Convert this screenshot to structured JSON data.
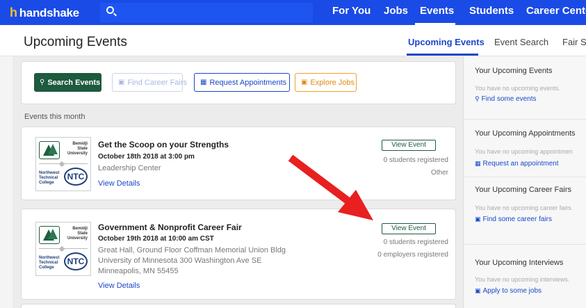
{
  "topnav": {
    "logo_text": "handshake",
    "search_icon": "search-icon",
    "items": [
      {
        "label": "For You"
      },
      {
        "label": "Jobs"
      },
      {
        "label": "Events"
      },
      {
        "label": "Students"
      },
      {
        "label": "Career Cente"
      }
    ],
    "active_item": "Events",
    "brand_color": "#1a4be6"
  },
  "subheader": {
    "title": "Upcoming Events",
    "tabs": [
      {
        "label": "Upcoming Events",
        "active": true
      },
      {
        "label": "Event Search"
      },
      {
        "label": "Fair S"
      }
    ]
  },
  "filters": {
    "search_events": "Search Events",
    "find_career_fairs": "Find Career Fairs",
    "request_appointments": "Request Appointments",
    "explore_jobs": "Explore Jobs"
  },
  "month_label": "Events this month",
  "events": [
    {
      "logo": {
        "school_line1": "Bemidji",
        "school_line2": "State",
        "school_line3": "University",
        "college_line1": "Northwest",
        "college_line2": "Technical",
        "college_line3": "College",
        "badge": "NTC"
      },
      "title": "Get the Scoop on your Strengths",
      "date": "October 18th 2018 at 3:00 pm",
      "location_lines": [
        "Leadership Center"
      ],
      "details_link": "View Details",
      "view_button": "View Event",
      "meta": [
        "0 students registered",
        "Other"
      ]
    },
    {
      "logo": {
        "school_line1": "Bemidji",
        "school_line2": "State",
        "school_line3": "University",
        "college_line1": "Northwest",
        "college_line2": "Technical",
        "college_line3": "College",
        "badge": "NTC"
      },
      "title": "Government & Nonprofit Career Fair",
      "date": "October 19th 2018 at 10:00 am CST",
      "location_lines": [
        "Great Hall, Ground Floor Coffman Memorial Union Bldg",
        "University of Minnesota 300 Washington Ave SE",
        "Minneapolis, MN 55455"
      ],
      "details_link": "View Details",
      "view_button": "View Event",
      "meta": [
        "0 students registered",
        "0 employers registered"
      ]
    }
  ],
  "sidebar": {
    "events": {
      "title": "Your Upcoming Events",
      "empty": "You have no upcoming events.",
      "link": "Find some events"
    },
    "appointments": {
      "title": "Your Upcoming Appointments",
      "empty": "You have no upcoming appointmen",
      "link": "Request an appointment"
    },
    "fairs": {
      "title": "Your Upcoming Career Fairs",
      "empty": "You have no upcoming career fairs.",
      "link": "Find some career fairs"
    },
    "interviews": {
      "title": "Your Upcoming Interviews",
      "empty": "You have no upcoming interviews.",
      "link": "Apply to some jobs"
    }
  },
  "colors": {
    "accent": "#1b47c9",
    "primary_button": "#1d5a3e",
    "warning": "#f0a12a",
    "annotation_arrow": "#e8201f"
  }
}
